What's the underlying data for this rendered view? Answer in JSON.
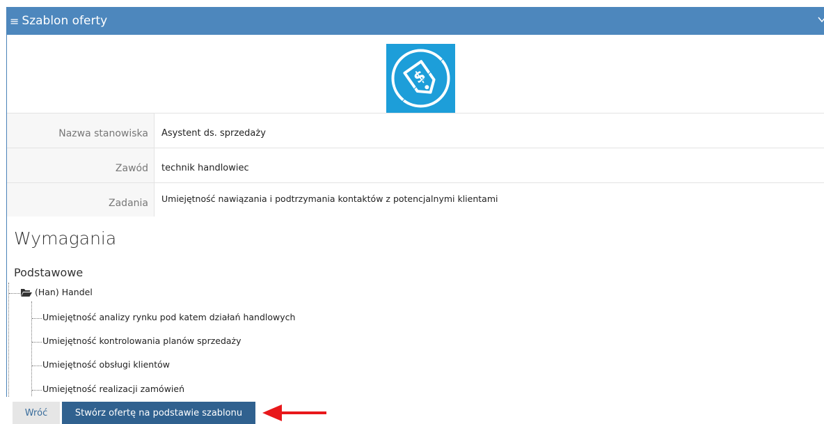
{
  "panel": {
    "title": "Szablon oferty",
    "menu_icon": "hamburger-icon",
    "collapse_icon": "chevron-down-icon",
    "logo_icon": "price-tag-dollar-icon",
    "accent_color": "#4d87bd",
    "logo_color": "#1d9ed9"
  },
  "details": [
    {
      "label": "Nazwa stanowiska",
      "value": "Asystent ds. sprzedaży"
    },
    {
      "label": "Zawód",
      "value": "technik handlowiec"
    },
    {
      "label": "Zadania",
      "value": "Umiejętność nawiązania i podtrzymania kontaktów z potencjalnymi klientami"
    }
  ],
  "requirements": {
    "heading": "Wymagania",
    "subheading": "Podstawowe",
    "group": {
      "label": "(Han) Handel",
      "icon": "folder-open-icon"
    },
    "items": [
      "Umiejętność analizy rynku pod katem działań handlowych",
      "Umiejętność kontrolowania planów sprzedaży",
      "Umiejętność obsługi klientów",
      "Umiejętność realizacji zamówień"
    ]
  },
  "buttons": {
    "back": "Wróć",
    "create": "Stwórz ofertę na podstawie szablonu"
  },
  "annotation": {
    "arrow_icon": "red-arrow-left-icon",
    "arrow_color": "#e8181b"
  }
}
